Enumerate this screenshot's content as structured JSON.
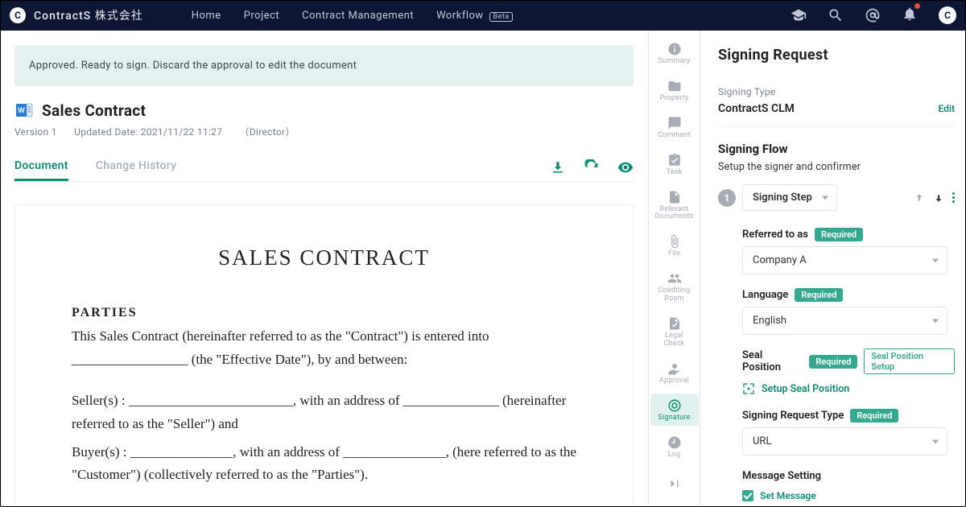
{
  "header": {
    "company": "ContractS 株式会社",
    "nav": [
      "Home",
      "Project",
      "Contract Management",
      "Workflow"
    ],
    "beta": "Beta",
    "avatar": "C"
  },
  "banner": "Approved. Ready to sign. Discard the approval to edit the document",
  "doc": {
    "title": "Sales Contract",
    "version": "Version 1",
    "updated": "Updated Date: 2021/11/22 11:27",
    "editor": "（Director）"
  },
  "tabs": {
    "document": "Document",
    "history": "Change History"
  },
  "docbody": {
    "title": "SALES CONTRACT",
    "parties_head": "PARTIES",
    "p1": "This Sales Contract (hereinafter referred to as the \"Contract\") is entered into _________________ (the \"Effective Date\"), by and between:",
    "p2": "Seller(s) : ________________________, with an address of ______________ (hereinafter referred to as the \"Seller\") and",
    "p3": "Buyer(s) : _______________, with an address of _______________, (here referred to as the \"Customer\") (collectively referred to as the \"Parties\")."
  },
  "rail": {
    "summary": "Summary",
    "property": "Property",
    "comment": "Comment",
    "task": "Task",
    "relevant": "Relevant\nDocuments",
    "file": "File",
    "coediting": "Coediting\nRoom",
    "legal": "Legal\nCheck",
    "approval": "Approval",
    "signature": "Signature",
    "log": "Log"
  },
  "right": {
    "title": "Signing Request",
    "signing_type_label": "Signing Type",
    "signing_type_value": "ContractS CLM",
    "edit": "Edit",
    "flow_title": "Signing Flow",
    "flow_sub": "Setup the signer and confirmer",
    "step_num": "1",
    "step_label": "Signing Step",
    "referred_label": "Referred to as",
    "required": "Required",
    "referred_value": "Company A",
    "language_label": "Language",
    "language_value": "English",
    "seal_label": "Seal Position",
    "seal_setup_badge": "Seal Position Setup",
    "seal_link": "Setup Seal Position",
    "request_type_label": "Signing Request Type",
    "request_type_value": "URL",
    "message_label": "Message Setting",
    "set_message": "Set Message"
  }
}
